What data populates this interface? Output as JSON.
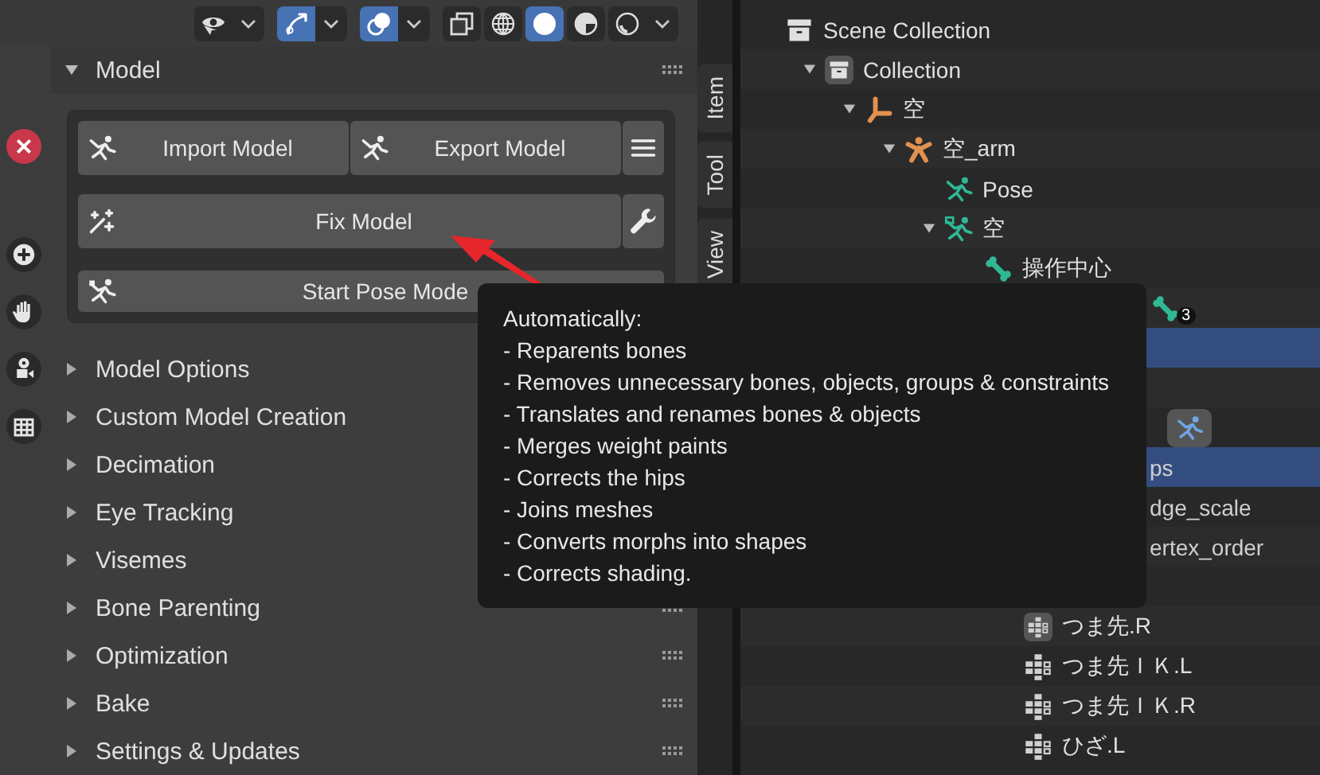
{
  "viewport_header": {
    "buttons": [
      {
        "kind": "visibility",
        "selected": false,
        "dropdown": true
      },
      {
        "kind": "gizmo",
        "selected": true,
        "dropdown": true
      },
      {
        "kind": "overlay",
        "selected": true,
        "dropdown": true
      },
      {
        "kind": "xray",
        "selected": false,
        "dropdown": false
      },
      {
        "kind": "wireframe",
        "selected": false,
        "dropdown": false
      },
      {
        "kind": "solid",
        "selected": true,
        "dropdown": false
      },
      {
        "kind": "material",
        "selected": false,
        "dropdown": false
      },
      {
        "kind": "rendered",
        "selected": false,
        "dropdown": true
      }
    ]
  },
  "viewport_tools": [
    {
      "kind": "close"
    },
    {
      "kind": "zoom"
    },
    {
      "kind": "pan"
    },
    {
      "kind": "camera"
    },
    {
      "kind": "grid"
    }
  ],
  "panel": {
    "title": "Model",
    "expanded": true,
    "button_rows": [
      [
        {
          "label": "Import Model"
        },
        {
          "label": "Export Model"
        },
        {}
      ],
      [
        {
          "label": "Fix Model"
        },
        {}
      ],
      [
        {
          "label": "Start Pose Mode"
        }
      ]
    ],
    "sections": [
      {
        "title": "Model Options",
        "expanded": false
      },
      {
        "title": "Custom Model Creation",
        "expanded": false
      },
      {
        "title": "Decimation",
        "expanded": false
      },
      {
        "title": "Eye Tracking",
        "expanded": false
      },
      {
        "title": "Visemes",
        "expanded": false
      },
      {
        "title": "Bone Parenting",
        "expanded": false
      },
      {
        "title": "Optimization",
        "expanded": false
      },
      {
        "title": "Bake",
        "expanded": false
      },
      {
        "title": "Settings & Updates",
        "expanded": false
      }
    ]
  },
  "sidebar_tabs": [
    {
      "label": "Item",
      "selected": false
    },
    {
      "label": "Tool",
      "selected": false
    },
    {
      "label": "View",
      "selected": false
    }
  ],
  "tooltip": {
    "lines": [
      "Automatically:",
      "- Reparents bones",
      "- Removes unnecessary bones, objects, groups & constraints",
      "- Translates and renames bones & objects",
      "- Merges weight paints",
      "- Corrects the hips",
      "- Joins meshes",
      "- Converts morphs into shapes",
      "- Corrects shading."
    ]
  },
  "outliner": {
    "items": [
      {
        "name": "Scene Collection",
        "kind": "collection",
        "selected": false,
        "children": [
          {
            "name": "Collection",
            "kind": "collection",
            "selected": false,
            "expanded": true,
            "children": [
              {
                "name": "空",
                "kind": "empty",
                "selected": false,
                "expanded": true,
                "children": [
                  {
                    "name": "空_arm",
                    "kind": "armature",
                    "selected": false,
                    "expanded": true,
                    "children": [
                      {
                        "name": "Pose",
                        "kind": "pose",
                        "selected": false
                      },
                      {
                        "name": "空",
                        "kind": "armature-data",
                        "selected": false,
                        "expanded": true,
                        "children": [
                          {
                            "name": "操作中心",
                            "kind": "bone",
                            "selected": false
                          },
                          {
                            "selected": false,
                            "covered": true,
                            "extra": {
                              "kind": "bone-count",
                              "count": "3"
                            }
                          }
                        ]
                      },
                      {
                        "selected": true,
                        "covered": true,
                        "children": [
                          {
                            "selected": false,
                            "covered": true
                          },
                          {
                            "selected": false,
                            "covered": true,
                            "extra": {
                              "kind": "pose-button"
                            }
                          },
                          {
                            "name": "ps",
                            "selected": true,
                            "covered": true,
                            "children": [
                              {
                                "name": "dge_scale",
                                "selected": false,
                                "covered": true
                              },
                              {
                                "name": "ertex_order",
                                "selected": false,
                                "covered": true
                              },
                              {
                                "selected": false,
                                "covered": true
                              },
                              {
                                "name": "つま先.R",
                                "kind": "vgroup",
                                "selected": false
                              },
                              {
                                "name": "つま先ＩＫ.L",
                                "kind": "vgroup",
                                "selected": false
                              },
                              {
                                "name": "つま先ＩＫ.R",
                                "kind": "vgroup",
                                "selected": false
                              },
                              {
                                "name": "ひざ.L",
                                "kind": "vgroup",
                                "selected": false
                              }
                            ]
                          }
                        ]
                      }
                    ]
                  }
                ]
              }
            ]
          }
        ]
      }
    ]
  }
}
